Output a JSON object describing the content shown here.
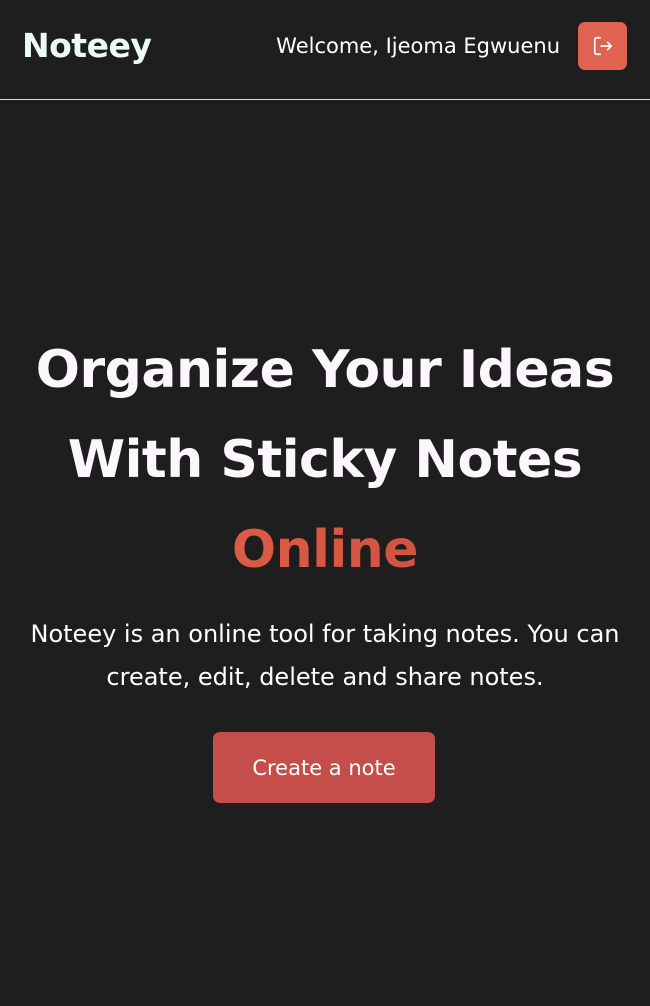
{
  "header": {
    "logo": "Noteey",
    "welcome": "Welcome, Ijeoma Egwuenu",
    "logout_icon": "logout-icon"
  },
  "hero": {
    "headline_line1": "Organize Your Ideas",
    "headline_line2": "With Sticky Notes",
    "headline_accent": "Online",
    "description": "Noteey is an online tool for taking notes. You can create, edit, delete and share notes.",
    "cta_label": "Create a note"
  },
  "colors": {
    "background": "#1e1e1e",
    "accent": "#e06352",
    "button": "#c64e4a",
    "text": "#ffffff"
  }
}
